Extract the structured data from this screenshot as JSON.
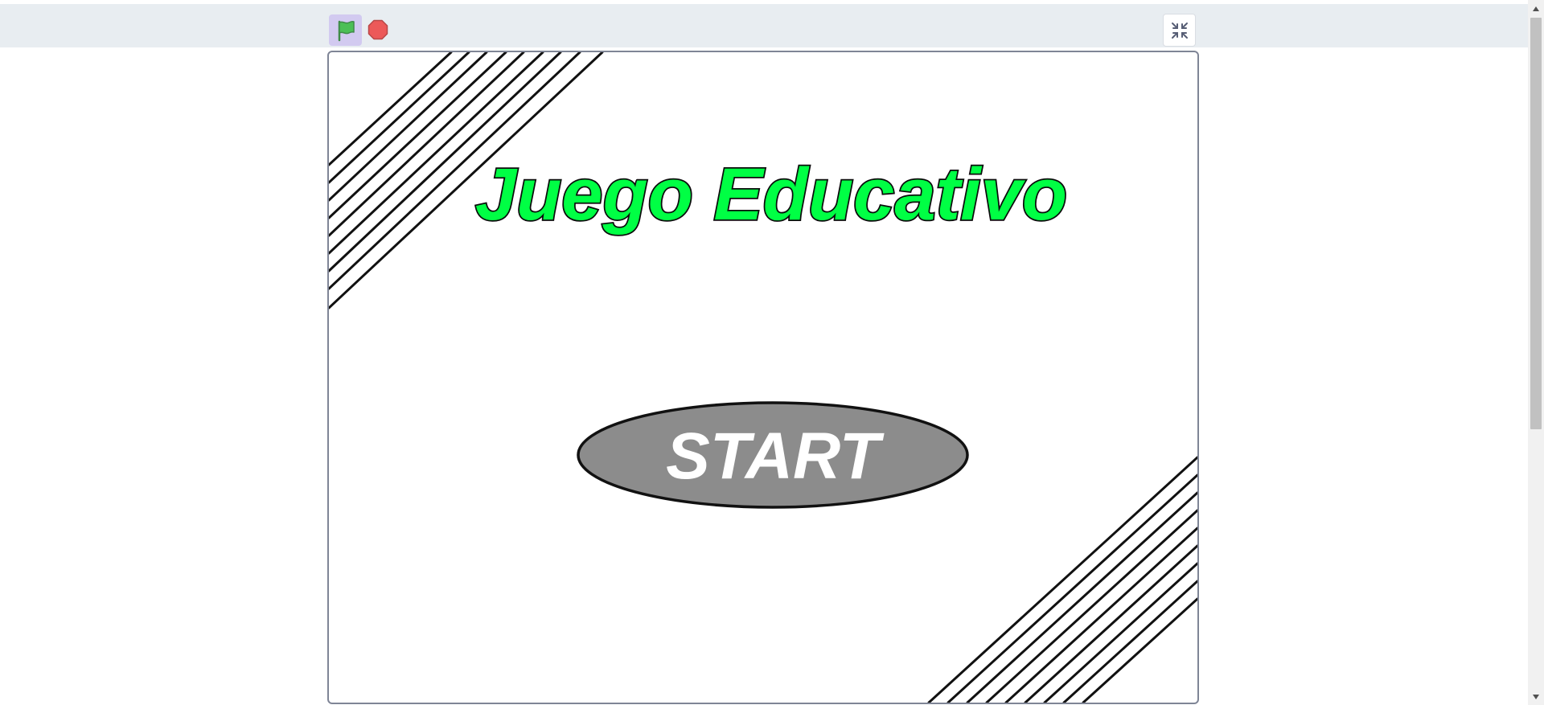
{
  "toolbar": {
    "green_flag_icon": "green-flag",
    "stop_icon": "stop-sign",
    "fullscreen_icon": "exit-fullscreen",
    "flag_active_bg": "#d2caf0",
    "flag_color": "#4cbf56",
    "stop_color": "#ec5959"
  },
  "stage": {
    "title": "Juego Educativo",
    "title_color": "#00ff44",
    "start_label": "START",
    "start_button_color": "#8c8c8c",
    "start_label_color": "#ffffff",
    "border_color": "#7f8596"
  },
  "scrollbar": {
    "up_icon": "scroll-up-arrow",
    "down_icon": "scroll-down-arrow"
  }
}
